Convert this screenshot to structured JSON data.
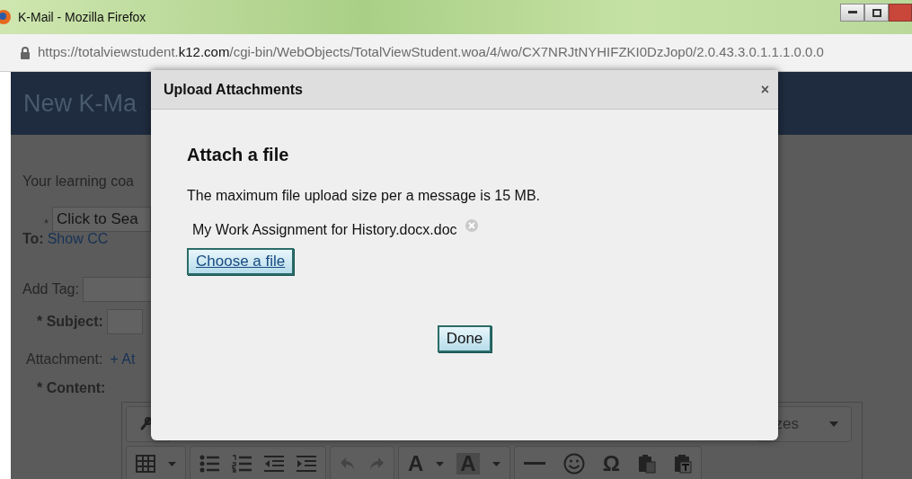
{
  "window": {
    "title": "K-Mail - Mozilla Firefox"
  },
  "address_bar": {
    "prefix": "https://totalviewstudent.",
    "domain": "k12.com",
    "path": "/cgi-bin/WebObjects/TotalViewStudent.woa/4/wo/CX7NRJtNYHIFZKI0DzJop0/2.0.43.3.0.1.1.1.0.0.0"
  },
  "page": {
    "header": "New K-Ma",
    "intro": "Your learning coa",
    "to": {
      "required": "*",
      "label": "To:",
      "placeholder": "Click to Sea",
      "show_cc": "Show CC"
    },
    "tag": {
      "label": "Add Tag:"
    },
    "subject": {
      "label": "* Subject:"
    },
    "attachment": {
      "label": "Attachment:",
      "link": "+ At"
    },
    "content": {
      "label": "* Content:",
      "sizes_dropdown": "zes",
      "toolbar_symbols": {
        "text_color": "A",
        "background_color": "A",
        "special_character": "Ω"
      }
    }
  },
  "dialog": {
    "title": "Upload Attachments",
    "close": "×",
    "heading": "Attach a file",
    "note": "The maximum file upload size per a message is 15 MB.",
    "files": [
      {
        "name": "My Work Assignment for History.docx.doc"
      }
    ],
    "choose_button": "Choose a file",
    "done_button": "Done"
  }
}
